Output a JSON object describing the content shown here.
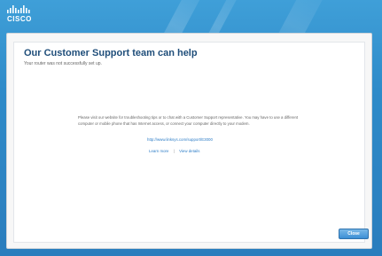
{
  "brand": {
    "logo_text": "CISCO"
  },
  "dialog": {
    "title": "Our Customer Support team can help",
    "subtitle": "Your router was not successfully set up.",
    "message": "Please visit our website for troubleshooting tips or to chat with a Customer Support representative. You may have to use a different computer or mobile phone that has Internet access, or connect your computer directly to your modem.",
    "support_url": "http://www.linksys.com/support/E3000",
    "links": {
      "learn_more": "Learn more",
      "view_details": "View details"
    },
    "primary_button": "Close"
  },
  "colors": {
    "background_blue": "#2f8bc9",
    "title_blue": "#1f4e7a",
    "link_blue": "#2d7dc7",
    "button_blue": "#3c8fd5"
  }
}
